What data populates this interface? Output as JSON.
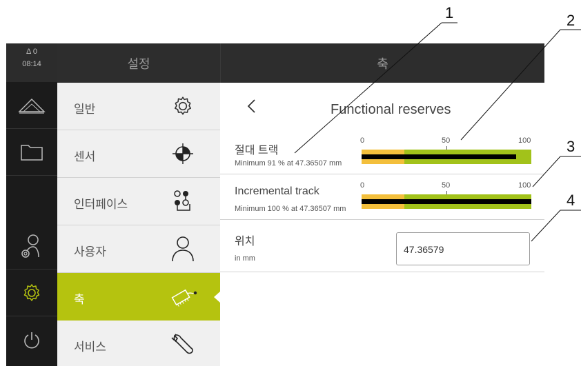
{
  "status": {
    "warning_icon": "triangle-warning-icon",
    "warning_count": "Δ 0",
    "time": "08:14"
  },
  "rail": {
    "items": [
      {
        "name": "measure-icon"
      },
      {
        "name": "folder-icon"
      },
      {
        "name": "user-settings-icon"
      },
      {
        "name": "settings-gear-icon"
      },
      {
        "name": "power-icon"
      }
    ]
  },
  "headers": {
    "left": "설정",
    "right": "축"
  },
  "menu": {
    "items": [
      {
        "label": "일반",
        "icon": "gear-icon"
      },
      {
        "label": "센서",
        "icon": "target-icon"
      },
      {
        "label": "인터페이스",
        "icon": "interface-icon"
      },
      {
        "label": "사용자",
        "icon": "user-icon"
      },
      {
        "label": "축",
        "icon": "axis-encoder-icon",
        "active": true
      },
      {
        "label": "서비스",
        "icon": "wrench-icon"
      }
    ]
  },
  "detail": {
    "back_icon": "chevron-left-icon",
    "title": "Functional reserves",
    "rows": [
      {
        "name": "절대 트랙",
        "sub": "Minimum 91 % at 47.36507 mm",
        "ticks": [
          "0",
          "50",
          "100"
        ],
        "value": 91
      },
      {
        "name": "Incremental track",
        "sub": "Minimum 100 % at 47.36507 mm",
        "ticks": [
          "0",
          "50",
          "100"
        ],
        "value": 100
      }
    ],
    "position": {
      "name": "위치",
      "unit": "in mm",
      "value": "47.36579"
    }
  },
  "callouts": [
    "1",
    "2",
    "3",
    "4"
  ],
  "colors": {
    "accent": "#b5c30f",
    "bar_green": "#a2c21a",
    "bar_yellow": "#f3bf3c",
    "dark": "#1b1b1b"
  }
}
